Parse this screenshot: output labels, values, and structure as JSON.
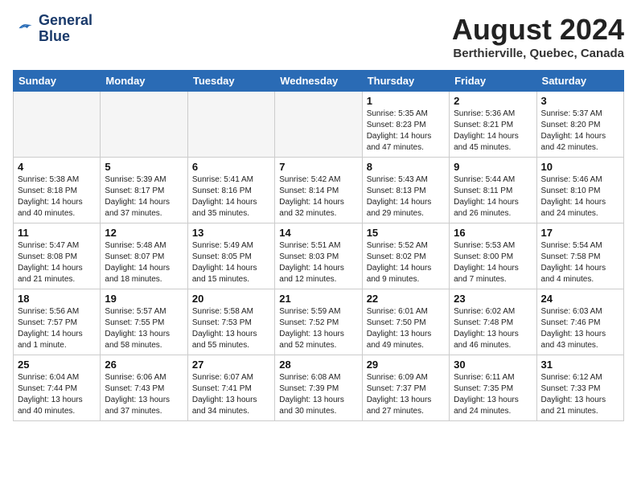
{
  "header": {
    "logo_line1": "General",
    "logo_line2": "Blue",
    "month_title": "August 2024",
    "location": "Berthierville, Quebec, Canada"
  },
  "days_of_week": [
    "Sunday",
    "Monday",
    "Tuesday",
    "Wednesday",
    "Thursday",
    "Friday",
    "Saturday"
  ],
  "weeks": [
    [
      {
        "day": "",
        "info": ""
      },
      {
        "day": "",
        "info": ""
      },
      {
        "day": "",
        "info": ""
      },
      {
        "day": "",
        "info": ""
      },
      {
        "day": "1",
        "info": "Sunrise: 5:35 AM\nSunset: 8:23 PM\nDaylight: 14 hours\nand 47 minutes."
      },
      {
        "day": "2",
        "info": "Sunrise: 5:36 AM\nSunset: 8:21 PM\nDaylight: 14 hours\nand 45 minutes."
      },
      {
        "day": "3",
        "info": "Sunrise: 5:37 AM\nSunset: 8:20 PM\nDaylight: 14 hours\nand 42 minutes."
      }
    ],
    [
      {
        "day": "4",
        "info": "Sunrise: 5:38 AM\nSunset: 8:18 PM\nDaylight: 14 hours\nand 40 minutes."
      },
      {
        "day": "5",
        "info": "Sunrise: 5:39 AM\nSunset: 8:17 PM\nDaylight: 14 hours\nand 37 minutes."
      },
      {
        "day": "6",
        "info": "Sunrise: 5:41 AM\nSunset: 8:16 PM\nDaylight: 14 hours\nand 35 minutes."
      },
      {
        "day": "7",
        "info": "Sunrise: 5:42 AM\nSunset: 8:14 PM\nDaylight: 14 hours\nand 32 minutes."
      },
      {
        "day": "8",
        "info": "Sunrise: 5:43 AM\nSunset: 8:13 PM\nDaylight: 14 hours\nand 29 minutes."
      },
      {
        "day": "9",
        "info": "Sunrise: 5:44 AM\nSunset: 8:11 PM\nDaylight: 14 hours\nand 26 minutes."
      },
      {
        "day": "10",
        "info": "Sunrise: 5:46 AM\nSunset: 8:10 PM\nDaylight: 14 hours\nand 24 minutes."
      }
    ],
    [
      {
        "day": "11",
        "info": "Sunrise: 5:47 AM\nSunset: 8:08 PM\nDaylight: 14 hours\nand 21 minutes."
      },
      {
        "day": "12",
        "info": "Sunrise: 5:48 AM\nSunset: 8:07 PM\nDaylight: 14 hours\nand 18 minutes."
      },
      {
        "day": "13",
        "info": "Sunrise: 5:49 AM\nSunset: 8:05 PM\nDaylight: 14 hours\nand 15 minutes."
      },
      {
        "day": "14",
        "info": "Sunrise: 5:51 AM\nSunset: 8:03 PM\nDaylight: 14 hours\nand 12 minutes."
      },
      {
        "day": "15",
        "info": "Sunrise: 5:52 AM\nSunset: 8:02 PM\nDaylight: 14 hours\nand 9 minutes."
      },
      {
        "day": "16",
        "info": "Sunrise: 5:53 AM\nSunset: 8:00 PM\nDaylight: 14 hours\nand 7 minutes."
      },
      {
        "day": "17",
        "info": "Sunrise: 5:54 AM\nSunset: 7:58 PM\nDaylight: 14 hours\nand 4 minutes."
      }
    ],
    [
      {
        "day": "18",
        "info": "Sunrise: 5:56 AM\nSunset: 7:57 PM\nDaylight: 14 hours\nand 1 minute."
      },
      {
        "day": "19",
        "info": "Sunrise: 5:57 AM\nSunset: 7:55 PM\nDaylight: 13 hours\nand 58 minutes."
      },
      {
        "day": "20",
        "info": "Sunrise: 5:58 AM\nSunset: 7:53 PM\nDaylight: 13 hours\nand 55 minutes."
      },
      {
        "day": "21",
        "info": "Sunrise: 5:59 AM\nSunset: 7:52 PM\nDaylight: 13 hours\nand 52 minutes."
      },
      {
        "day": "22",
        "info": "Sunrise: 6:01 AM\nSunset: 7:50 PM\nDaylight: 13 hours\nand 49 minutes."
      },
      {
        "day": "23",
        "info": "Sunrise: 6:02 AM\nSunset: 7:48 PM\nDaylight: 13 hours\nand 46 minutes."
      },
      {
        "day": "24",
        "info": "Sunrise: 6:03 AM\nSunset: 7:46 PM\nDaylight: 13 hours\nand 43 minutes."
      }
    ],
    [
      {
        "day": "25",
        "info": "Sunrise: 6:04 AM\nSunset: 7:44 PM\nDaylight: 13 hours\nand 40 minutes."
      },
      {
        "day": "26",
        "info": "Sunrise: 6:06 AM\nSunset: 7:43 PM\nDaylight: 13 hours\nand 37 minutes."
      },
      {
        "day": "27",
        "info": "Sunrise: 6:07 AM\nSunset: 7:41 PM\nDaylight: 13 hours\nand 34 minutes."
      },
      {
        "day": "28",
        "info": "Sunrise: 6:08 AM\nSunset: 7:39 PM\nDaylight: 13 hours\nand 30 minutes."
      },
      {
        "day": "29",
        "info": "Sunrise: 6:09 AM\nSunset: 7:37 PM\nDaylight: 13 hours\nand 27 minutes."
      },
      {
        "day": "30",
        "info": "Sunrise: 6:11 AM\nSunset: 7:35 PM\nDaylight: 13 hours\nand 24 minutes."
      },
      {
        "day": "31",
        "info": "Sunrise: 6:12 AM\nSunset: 7:33 PM\nDaylight: 13 hours\nand 21 minutes."
      }
    ]
  ]
}
